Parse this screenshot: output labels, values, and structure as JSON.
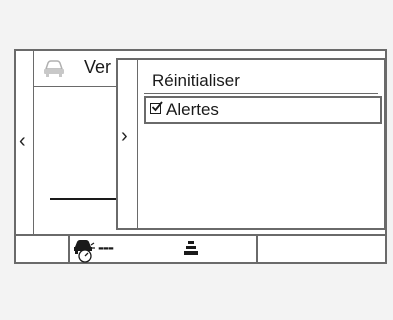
{
  "background_page": {
    "title": "Ver",
    "car_icon": "car-icon"
  },
  "menu": {
    "items": [
      {
        "label": "Réinitialiser"
      },
      {
        "label": "Alertes",
        "checked": true
      }
    ]
  },
  "status_bar": {
    "indicator_text": "---",
    "icons": [
      "driver-assist-icon",
      "lane-icon"
    ]
  },
  "colors": {
    "border": "#6a6a6a",
    "text": "#1a1a1a",
    "background": "#ffffff"
  }
}
